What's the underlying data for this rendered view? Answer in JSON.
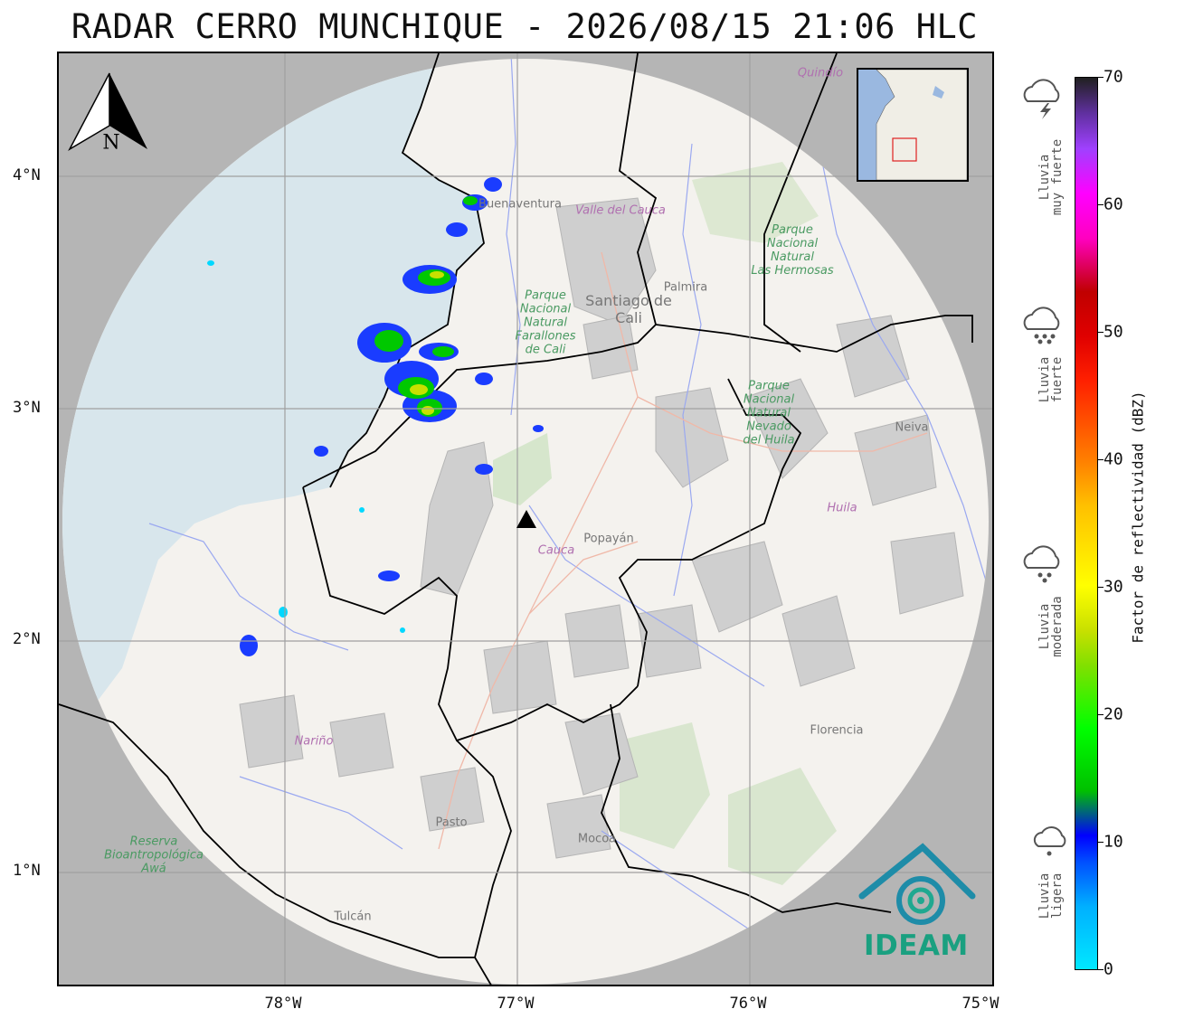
{
  "title": "RADAR CERRO MUNCHIQUE - 2026/08/15 21:06 HLC",
  "map": {
    "x_ticks": [
      "78°W",
      "77°W",
      "76°W",
      "75°W"
    ],
    "y_ticks": [
      "4°N",
      "3°N",
      "2°N",
      "1°N"
    ],
    "radar_site_icon": "triangle-icon",
    "north_arrow_label": "N",
    "places": {
      "cali": "Santiago de\nCali",
      "palmira": "Palmira",
      "popayan": "Popayán",
      "cauca": "Cauca",
      "neiva": "Neiva",
      "huila": "Huila",
      "narino": "Nariño",
      "pasto": "Pasto",
      "mocoa": "Mocoa",
      "florencia": "Florencia",
      "tulcan": "Tulcán",
      "quindio": "Quindío",
      "buenaventura": "Buenaventura",
      "valle": "Valle del Cauca",
      "farallones": "Parque\nNacional\nNatural\nFarallones\nde Cali",
      "hermosas": "Parque\nNacional\nNatural\nLas Hermosas",
      "nevado": "Parque\nNacional\nNatural\nNevado\ndel Huila",
      "awa": "Reserva\nBioantropológica\nAwá"
    }
  },
  "colorbar": {
    "label": "Factor de reflectividad (dBZ)",
    "ticks": [
      "0",
      "10",
      "20",
      "30",
      "40",
      "50",
      "60",
      "70"
    ],
    "range": [
      0,
      70
    ]
  },
  "rain_categories": [
    {
      "label_1": "Lluvia",
      "label_2": "ligera",
      "icon": "light-rain-cloud-icon"
    },
    {
      "label_1": "Lluvia",
      "label_2": "moderada",
      "icon": "moderate-rain-cloud-icon"
    },
    {
      "label_1": "Lluvia",
      "label_2": "fuerte",
      "icon": "heavy-rain-cloud-icon"
    },
    {
      "label_1": "Lluvia",
      "label_2": "muy fuerte",
      "icon": "thunderstorm-cloud-icon"
    }
  ],
  "logo": {
    "text": "IDEAM",
    "icon": "ideam-logo-icon"
  },
  "colors": {
    "ocean": "#a9d2e8",
    "outside_range": "#b3b3b3",
    "border": "#000000",
    "logo": "#1aa080"
  }
}
